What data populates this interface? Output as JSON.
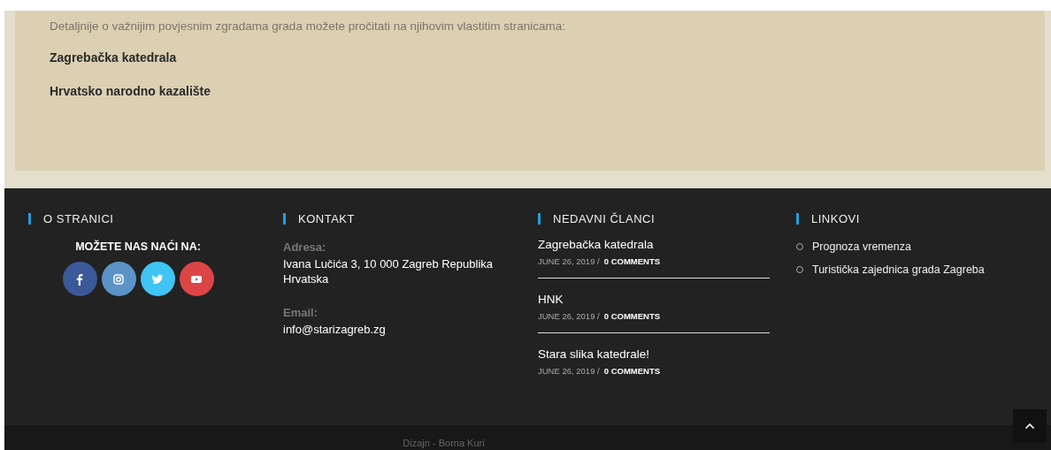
{
  "content": {
    "intro": "Detaljnije o važnijim povjesnim zgradama grada možete pročitati na njihovim vlastitim stranicama:",
    "links": [
      "Zagrebačka katedrala",
      "Hrvatsko narodno kazalište"
    ]
  },
  "footer": {
    "about": {
      "title": "O STRANICI",
      "subtitle": "MOŽETE NAS NAĆI NA:",
      "social": [
        {
          "kind": "facebook",
          "color": "#3b5998"
        },
        {
          "kind": "instagram",
          "color": "#5b93c8"
        },
        {
          "kind": "twitter",
          "color": "#40c4f5"
        },
        {
          "kind": "youtube",
          "color": "#dc4545"
        }
      ]
    },
    "contact": {
      "title": "KONTAKT",
      "fields": [
        {
          "label": "Adresa:",
          "value": "Ivana Lučića 3, 10 000 Zagreb Republika Hrvatska"
        },
        {
          "label": "Email:",
          "value": "info@starizagreb.zg"
        }
      ]
    },
    "recent": {
      "title": "NEDAVNI ČLANCI",
      "posts": [
        {
          "title": "Zagrebačka katedrala",
          "date": "JUNE 26, 2019 /",
          "comments": "0 COMMENTS"
        },
        {
          "title": "HNK",
          "date": "JUNE 26, 2019 /",
          "comments": "0 COMMENTS"
        },
        {
          "title": "Stara slika katedrale!",
          "date": "JUNE 26, 2019 /",
          "comments": "0 COMMENTS"
        }
      ]
    },
    "links": {
      "title": "LINKOVI",
      "items": [
        "Prognoza vremenza",
        "Turistička zajednica grada Zagreba"
      ]
    }
  },
  "bottom_bar": {
    "credit": "Dizajn - Borna Kuri"
  }
}
